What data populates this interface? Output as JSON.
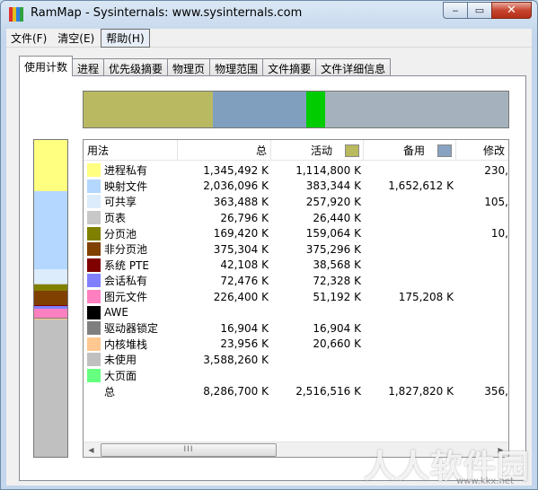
{
  "window": {
    "title": "RamMap - Sysinternals: www.sysinternals.com",
    "controls": {
      "minimize": "‒",
      "maximize": "▭",
      "close": "✕"
    }
  },
  "menu": [
    {
      "label": "文件(F)"
    },
    {
      "label": "清空(E)"
    },
    {
      "label": "帮助(H)"
    }
  ],
  "tabs": [
    {
      "label": "使用计数",
      "selected": true
    },
    {
      "label": "进程"
    },
    {
      "label": "优先级摘要"
    },
    {
      "label": "物理页"
    },
    {
      "label": "物理范围"
    },
    {
      "label": "文件摘要"
    },
    {
      "label": "文件详细信息"
    }
  ],
  "colors": {
    "process_private": "#ffff80",
    "mapped_file": "#b3d7ff",
    "shareable": "#dcecfc",
    "page_table": "#c8c8c8",
    "paged_pool": "#808000",
    "nonpaged_pool": "#804000",
    "system_pte": "#800000",
    "session_private": "#8080ff",
    "metafile": "#ff80c0",
    "awe": "#000000",
    "driver_locked": "#7f7f7f",
    "kernel_stack": "#ffc890",
    "unused": "#c0c0c0",
    "large_page": "#66ff80",
    "active_swatch": "#b9b95e",
    "standby_swatch": "#88a3c1",
    "top_active": "#b9b962",
    "top_standby": "#809fbf",
    "top_modified": "#00cc00",
    "top_rest": "#a5b2bd"
  },
  "top_bar": {
    "active_fraction": 0.304,
    "standby_fraction": 0.221,
    "modified_fraction": 0.043,
    "rest_fraction": 0.432
  },
  "columns": {
    "name": "用法",
    "total": "总",
    "active": "活动",
    "standby": "备用",
    "modified": "修改"
  },
  "rows": [
    {
      "name": "进程私有",
      "color": "#ffff80",
      "total": "1,345,492 K",
      "active": "1,114,800 K",
      "standby": "",
      "modified": "230,"
    },
    {
      "name": "映射文件",
      "color": "#b3d7ff",
      "total": "2,036,096 K",
      "active": "383,344 K",
      "standby": "1,652,612 K",
      "modified": ""
    },
    {
      "name": "可共享",
      "color": "#dcecfc",
      "total": "363,488 K",
      "active": "257,920 K",
      "standby": "",
      "modified": "105,"
    },
    {
      "name": "页表",
      "color": "#c8c8c8",
      "total": "26,796 K",
      "active": "26,440 K",
      "standby": "",
      "modified": ""
    },
    {
      "name": "分页池",
      "color": "#808000",
      "total": "169,420 K",
      "active": "159,064 K",
      "standby": "",
      "modified": "10,"
    },
    {
      "name": "非分页池",
      "color": "#804000",
      "total": "375,304 K",
      "active": "375,296 K",
      "standby": "",
      "modified": ""
    },
    {
      "name": "系统 PTE",
      "color": "#800000",
      "total": "42,108 K",
      "active": "38,568 K",
      "standby": "",
      "modified": ""
    },
    {
      "name": "会话私有",
      "color": "#8080ff",
      "total": "72,476 K",
      "active": "72,328 K",
      "standby": "",
      "modified": ""
    },
    {
      "name": "图元文件",
      "color": "#ff80c0",
      "total": "226,400 K",
      "active": "51,192 K",
      "standby": "175,208 K",
      "modified": ""
    },
    {
      "name": "AWE",
      "color": "#000000",
      "total": "",
      "active": "",
      "standby": "",
      "modified": ""
    },
    {
      "name": "驱动器锁定",
      "color": "#7f7f7f",
      "total": "16,904 K",
      "active": "16,904 K",
      "standby": "",
      "modified": ""
    },
    {
      "name": "内核堆栈",
      "color": "#ffc890",
      "total": "23,956 K",
      "active": "20,660 K",
      "standby": "",
      "modified": ""
    },
    {
      "name": "未使用",
      "color": "#c0c0c0",
      "total": "3,588,260 K",
      "active": "",
      "standby": "",
      "modified": ""
    },
    {
      "name": "大页面",
      "color": "#66ff80",
      "total": "",
      "active": "",
      "standby": "",
      "modified": ""
    },
    {
      "name": "总",
      "color": "",
      "total": "8,286,700 K",
      "active": "2,516,516 K",
      "standby": "1,827,820 K",
      "modified": "356,"
    }
  ],
  "side_bar": [
    {
      "color": "#ffff80",
      "fraction": 0.162
    },
    {
      "color": "#b3d7ff",
      "fraction": 0.246
    },
    {
      "color": "#dcecfc",
      "fraction": 0.044
    },
    {
      "color": "#c8c8c8",
      "fraction": 0.003
    },
    {
      "color": "#808000",
      "fraction": 0.02
    },
    {
      "color": "#804000",
      "fraction": 0.045
    },
    {
      "color": "#800000",
      "fraction": 0.005
    },
    {
      "color": "#8080ff",
      "fraction": 0.009
    },
    {
      "color": "#ff80c0",
      "fraction": 0.027
    },
    {
      "color": "#7f7f7f",
      "fraction": 0.002
    },
    {
      "color": "#ffc890",
      "fraction": 0.003
    },
    {
      "color": "#c0c0c0",
      "fraction": 0.434
    }
  ],
  "scrollbar": {
    "thumb_grip": "III",
    "left_arrow": "◀",
    "right_arrow": "▶"
  },
  "watermark": {
    "text": "人人软件园",
    "url": "www.kkx.net"
  }
}
